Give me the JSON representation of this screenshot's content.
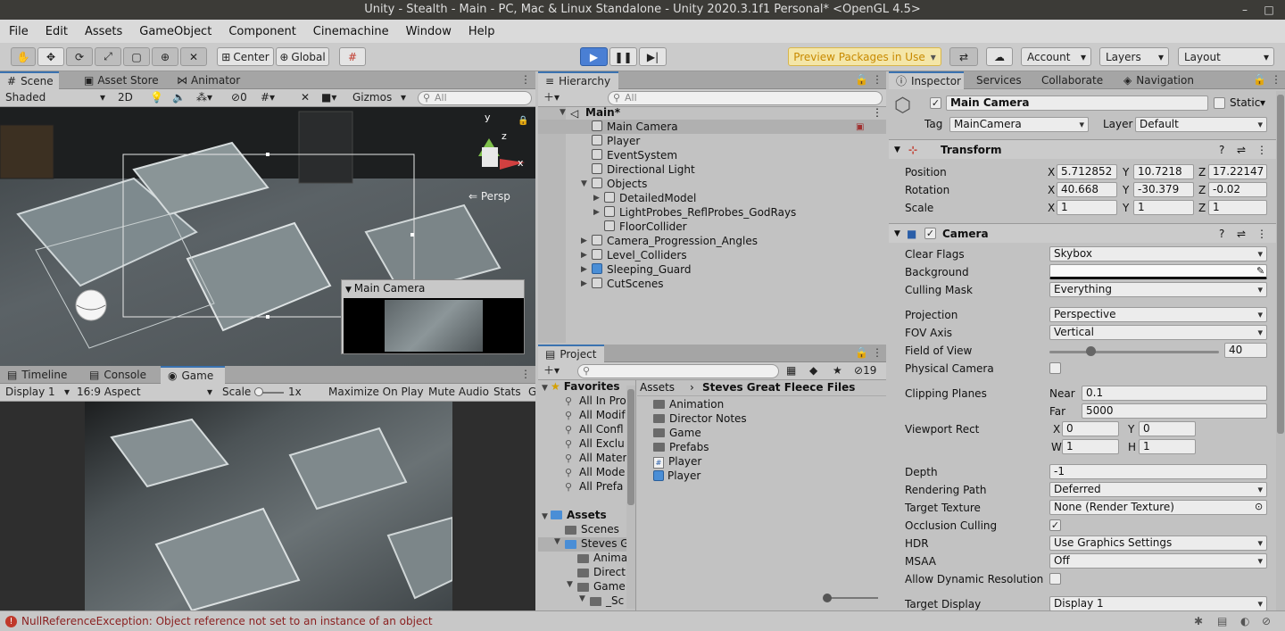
{
  "window": {
    "title": "Unity - Stealth - Main - PC, Mac & Linux Standalone - Unity 2020.3.1f1 Personal* <OpenGL 4.5>"
  },
  "menu": [
    "File",
    "Edit",
    "Assets",
    "GameObject",
    "Component",
    "Cinemachine",
    "Window",
    "Help"
  ],
  "toolbar": {
    "pivot": "Center",
    "space": "Global",
    "packages": "Preview Packages in Use",
    "account": "Account",
    "layers": "Layers",
    "layout": "Layout"
  },
  "scene": {
    "tabs": [
      "Scene",
      "Asset Store",
      "Animator"
    ],
    "shading": "Shaded",
    "mode2d": "2D",
    "gizmos": "Gizmos",
    "search_placeholder": "All",
    "hidden_count": "0",
    "persp": "Persp",
    "gizmo_x": "x",
    "gizmo_y": "y",
    "gizmo_z": "z",
    "preview_title": "Main Camera"
  },
  "game": {
    "tabs": [
      "Timeline",
      "Console",
      "Game"
    ],
    "display": "Display 1",
    "aspect": "16:9 Aspect",
    "scale_label": "Scale",
    "scale_value": "1x",
    "maximize": "Maximize On Play",
    "mute": "Mute Audio",
    "stats": "Stats",
    "gizmos_cut": "G"
  },
  "hierarchy": {
    "tab": "Hierarchy",
    "search_placeholder": "All",
    "items": [
      {
        "label": "Main*",
        "indent": 0,
        "arrow": "▼",
        "scene": true
      },
      {
        "label": "Main Camera",
        "indent": 1,
        "arrow": "",
        "selected": true
      },
      {
        "label": "Player",
        "indent": 1,
        "arrow": ""
      },
      {
        "label": "EventSystem",
        "indent": 1,
        "arrow": ""
      },
      {
        "label": "Directional Light",
        "indent": 1,
        "arrow": ""
      },
      {
        "label": "Objects",
        "indent": 1,
        "arrow": "▼"
      },
      {
        "label": "DetailedModel",
        "indent": 2,
        "arrow": "▶"
      },
      {
        "label": "LightProbes_ReflProbes_GodRays",
        "indent": 2,
        "arrow": "▶"
      },
      {
        "label": "FloorCollider",
        "indent": 2,
        "arrow": ""
      },
      {
        "label": "Camera_Progression_Angles",
        "indent": 1,
        "arrow": "▶"
      },
      {
        "label": "Level_Colliders",
        "indent": 1,
        "arrow": "▶"
      },
      {
        "label": "Sleeping_Guard",
        "indent": 1,
        "arrow": "▶",
        "blue": true
      },
      {
        "label": "CutScenes",
        "indent": 1,
        "arrow": "▶"
      }
    ]
  },
  "project": {
    "tab": "Project",
    "count": "19",
    "favorites_label": "Favorites",
    "favorites": [
      "All In Pro",
      "All Modif",
      "All Confl",
      "All Exclu",
      "All Mater",
      "All Mode",
      "All Prefa"
    ],
    "assets_label": "Assets",
    "assets_tree": [
      {
        "label": "Scenes",
        "indent": 1,
        "arrow": ""
      },
      {
        "label": "Steves G",
        "indent": 1,
        "arrow": "▼",
        "selected": true
      },
      {
        "label": "Anima",
        "indent": 2,
        "arrow": ""
      },
      {
        "label": "Direct",
        "indent": 2,
        "arrow": ""
      },
      {
        "label": "Game",
        "indent": 2,
        "arrow": "▼"
      },
      {
        "label": "_Sc",
        "indent": 3,
        "arrow": "▼"
      }
    ],
    "breadcrumb_root": "Assets",
    "breadcrumb_current": "Steves Great Fleece Files",
    "files": [
      {
        "label": "Animation",
        "type": "folder"
      },
      {
        "label": "Director Notes",
        "type": "folder"
      },
      {
        "label": "Game",
        "type": "folder"
      },
      {
        "label": "Prefabs",
        "type": "folder"
      },
      {
        "label": "Player",
        "type": "script"
      },
      {
        "label": "Player",
        "type": "prefab"
      }
    ]
  },
  "inspector": {
    "tabs": [
      "Inspector",
      "Services",
      "Collaborate",
      "Navigation"
    ],
    "object_name": "Main Camera",
    "static_label": "Static",
    "tag_label": "Tag",
    "tag": "MainCamera",
    "layer_label": "Layer",
    "layer": "Default",
    "transform": {
      "title": "Transform",
      "position_label": "Position",
      "rotation_label": "Rotation",
      "scale_label": "Scale",
      "position": {
        "x": "5.712852",
        "y": "10.7218",
        "z": "17.22147"
      },
      "rotation": {
        "x": "40.668",
        "y": "-30.379",
        "z": "-0.02"
      },
      "scale": {
        "x": "1",
        "y": "1",
        "z": "1"
      }
    },
    "camera": {
      "title": "Camera",
      "clear_flags_label": "Clear Flags",
      "clear_flags": "Skybox",
      "background_label": "Background",
      "culling_mask_label": "Culling Mask",
      "culling_mask": "Everything",
      "projection_label": "Projection",
      "projection": "Perspective",
      "fov_axis_label": "FOV Axis",
      "fov_axis": "Vertical",
      "fov_label": "Field of View",
      "fov": "40",
      "fov_fraction": 0.24,
      "physical_label": "Physical Camera",
      "clipping_label": "Clipping Planes",
      "near_label": "Near",
      "near": "0.1",
      "far_label": "Far",
      "far": "5000",
      "viewport_label": "Viewport Rect",
      "vp_x": "0",
      "vp_y": "0",
      "vp_w": "1",
      "vp_h": "1",
      "depth_label": "Depth",
      "depth": "-1",
      "rendering_path_label": "Rendering Path",
      "rendering_path": "Deferred",
      "target_texture_label": "Target Texture",
      "target_texture": "None (Render Texture)",
      "occlusion_label": "Occlusion Culling",
      "hdr_label": "HDR",
      "hdr": "Use Graphics Settings",
      "msaa_label": "MSAA",
      "msaa": "Off",
      "dynres_label": "Allow Dynamic Resolution",
      "target_display_label": "Target Display",
      "target_display": "Display 1"
    }
  },
  "status": {
    "message": "NullReferenceException: Object reference not set to an instance of an object"
  },
  "colors": {
    "accent": "#3a72b0",
    "play_blue": "#4a7fd4",
    "error_red": "#c0392b",
    "packages_bg": "#f4e6a8",
    "packages_text": "#c88a00"
  }
}
